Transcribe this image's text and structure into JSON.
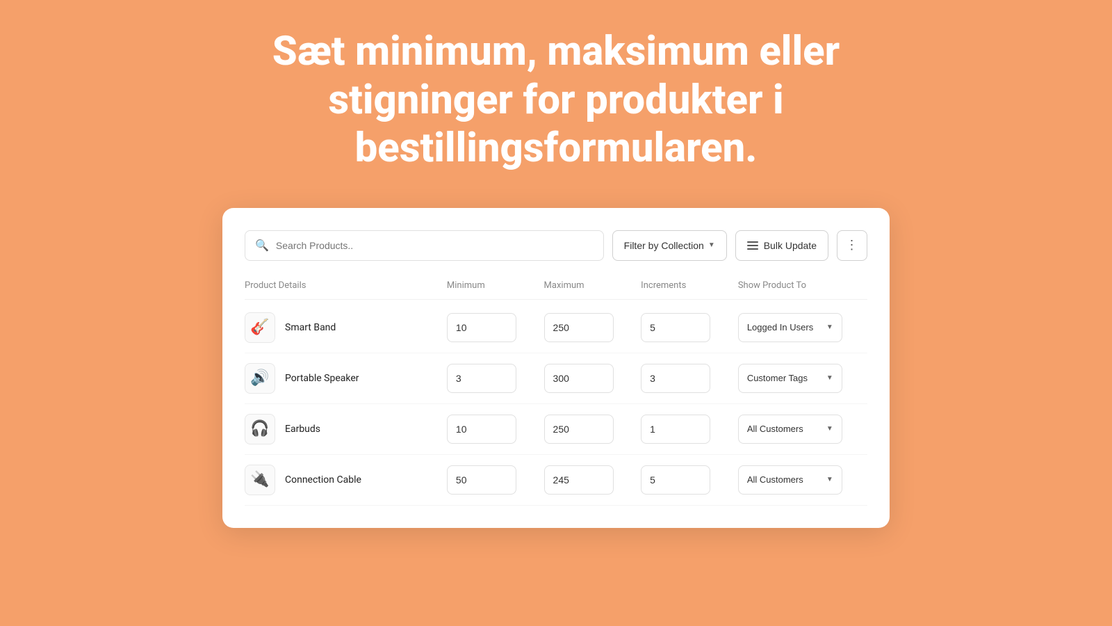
{
  "hero": {
    "line1": "Sæt minimum, maksimum eller",
    "line2": "stigninger for produkter i",
    "line3": "bestillingsformularen."
  },
  "toolbar": {
    "search_placeholder": "Search Products..",
    "filter_label": "Filter by Collection",
    "bulk_label": "Bulk Update",
    "more_icon": "⋮"
  },
  "table": {
    "headers": {
      "product": "Product Details",
      "minimum": "Minimum",
      "maximum": "Maximum",
      "increments": "Increments",
      "show_to": "Show Product To"
    },
    "rows": [
      {
        "id": 1,
        "icon": "🎸",
        "name": "Smart Band",
        "minimum": "10",
        "maximum": "250",
        "increments": "5",
        "show_to": "Logged In Users"
      },
      {
        "id": 2,
        "icon": "🔊",
        "name": "Portable Speaker",
        "minimum": "3",
        "maximum": "300",
        "increments": "3",
        "show_to": "Customer Tags"
      },
      {
        "id": 3,
        "icon": "🎧",
        "name": "Earbuds",
        "minimum": "10",
        "maximum": "250",
        "increments": "1",
        "show_to": "All Customers"
      },
      {
        "id": 4,
        "icon": "🔌",
        "name": "Connection Cable",
        "minimum": "50",
        "maximum": "245",
        "increments": "5",
        "show_to": "All Customers"
      }
    ]
  }
}
